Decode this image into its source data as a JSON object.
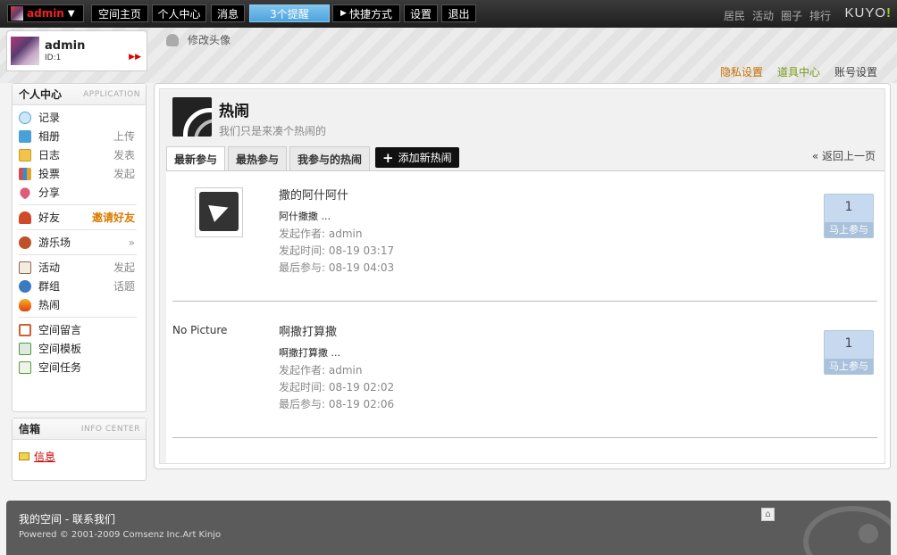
{
  "topbar": {
    "username": "admin",
    "nav": [
      "空间主页",
      "个人中心",
      "消息"
    ],
    "notice": "3个提醒",
    "shortcut": "快捷方式",
    "settings": "设置",
    "logout": "退出",
    "right_links": [
      "居民",
      "活动",
      "圈子",
      "排行"
    ],
    "brand": "KUYO",
    "brand_suffix": "!"
  },
  "profile": {
    "name": "admin",
    "id": "ID:1",
    "edit_avatar": "修改头像"
  },
  "header_links": [
    "隐私设置",
    "道具中心",
    "账号设置"
  ],
  "sidebar": {
    "title": "个人中心",
    "title_en": "APPLICATION",
    "items": [
      {
        "label": "记录",
        "action": "",
        "icon": "record-icon",
        "color": "#5aa7e0"
      },
      {
        "label": "相册",
        "action": "上传",
        "icon": "album-icon",
        "color": "#4aa0d8"
      },
      {
        "label": "日志",
        "action": "发表",
        "icon": "blog-icon",
        "color": "#e0a52a"
      },
      {
        "label": "投票",
        "action": "发起",
        "icon": "poll-icon",
        "color": "#d94b4b"
      },
      {
        "label": "分享",
        "action": "",
        "icon": "share-icon",
        "color": "#e05a7a"
      },
      {
        "label": "好友",
        "action": "邀请好友",
        "icon": "friend-icon",
        "color": "#d04a2a"
      },
      {
        "label": "游乐场",
        "action": "",
        "icon": "playground-icon",
        "color": "#c05028"
      },
      {
        "label": "活动",
        "action": "发起",
        "icon": "event-icon",
        "color": "#8a6a4a"
      },
      {
        "label": "群组",
        "action": "话题",
        "icon": "group-icon",
        "color": "#3a7ac0"
      },
      {
        "label": "热闹",
        "action": "",
        "icon": "hot-icon",
        "color": "#e85a10"
      },
      {
        "label": "空间留言",
        "action": "",
        "icon": "guestbook-icon",
        "color": "#d06030"
      },
      {
        "label": "空间模板",
        "action": "",
        "icon": "template-icon",
        "color": "#4a9a3a"
      },
      {
        "label": "空间任务",
        "action": "",
        "icon": "task-icon",
        "color": "#5a9a3a"
      }
    ]
  },
  "infobox": {
    "title": "信箱",
    "title_en": "INFO CENTER",
    "item": "信息"
  },
  "main": {
    "title": "热闹",
    "subtitle": "我们只是来凑个热闹的",
    "tabs": [
      "最新参与",
      "最热参与",
      "我参与的热闹"
    ],
    "add_label": "添加新热闹",
    "back": "« 返回上一页",
    "items": [
      {
        "title": "撒的阿什阿什",
        "desc": "阿什撒撒 ...",
        "author": "发起作者: admin",
        "start": "发起时间: 08-19 03:17",
        "last": "最后参与: 08-19 04:03",
        "count": "1",
        "join": "马上参与"
      },
      {
        "title": "啊撒打算撒",
        "desc": "啊撒打算撒 ...",
        "author": "发起作者: admin",
        "start": "发起时间: 08-19 02:02",
        "last": "最后参与: 08-19 02:06",
        "count": "1",
        "join": "马上参与"
      }
    ],
    "nopic_line1": "No",
    "nopic_line2": "Picture"
  },
  "footer": {
    "links": "我的空间 - 联系我们",
    "copyright": "Powered © 2001-2009 Comsenz Inc.Art Kinjo"
  }
}
